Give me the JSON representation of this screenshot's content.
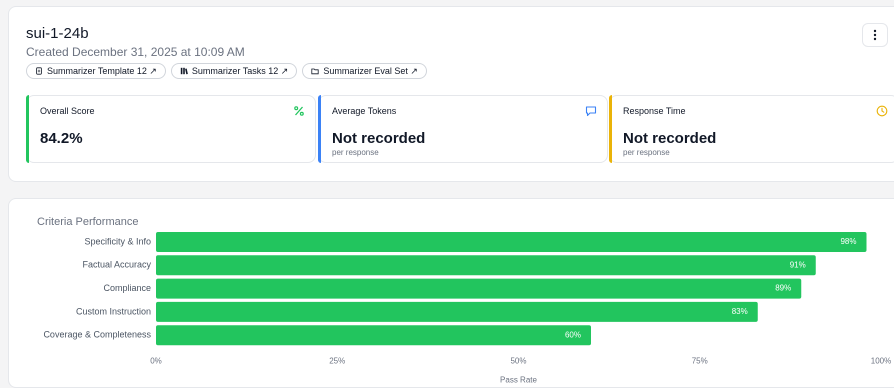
{
  "header": {
    "title": "sui-1-24b",
    "created": "Created December 31, 2025 at 10:09 AM",
    "pills": [
      {
        "label": "Summarizer Template 12 ↗",
        "icon": "document-icon"
      },
      {
        "label": "Summarizer Tasks 12 ↗",
        "icon": "tasks-icon"
      },
      {
        "label": "Summarizer Eval Set ↗",
        "icon": "folder-icon"
      }
    ],
    "menu_icon": "more-vertical-icon"
  },
  "metrics": [
    {
      "label": "Overall Score",
      "value": "84.2%",
      "sub": "",
      "icon": "percent-icon",
      "color": "#22c55e"
    },
    {
      "label": "Average Tokens",
      "value": "Not recorded",
      "sub": "per response",
      "icon": "message-icon",
      "color": "#3b82f6"
    },
    {
      "label": "Response Time",
      "value": "Not recorded",
      "sub": "per response",
      "icon": "clock-icon",
      "color": "#eab308"
    }
  ],
  "chart_data": {
    "type": "bar",
    "orientation": "horizontal",
    "title": "Criteria Performance",
    "categories": [
      "Specificity & Info",
      "Factual Accuracy",
      "Compliance",
      "Custom Instruction",
      "Coverage & Completeness"
    ],
    "values": [
      98,
      91,
      89,
      83,
      60
    ],
    "value_labels": [
      "98%",
      "91%",
      "89%",
      "83%",
      "60%"
    ],
    "xlabel": "Pass Rate",
    "xlim": [
      0,
      100
    ],
    "xticks": [
      0,
      25,
      50,
      75,
      100
    ],
    "xtick_labels": [
      "0%",
      "25%",
      "50%",
      "75%",
      "100%"
    ],
    "bar_color": "#22c55e",
    "grid": false
  }
}
